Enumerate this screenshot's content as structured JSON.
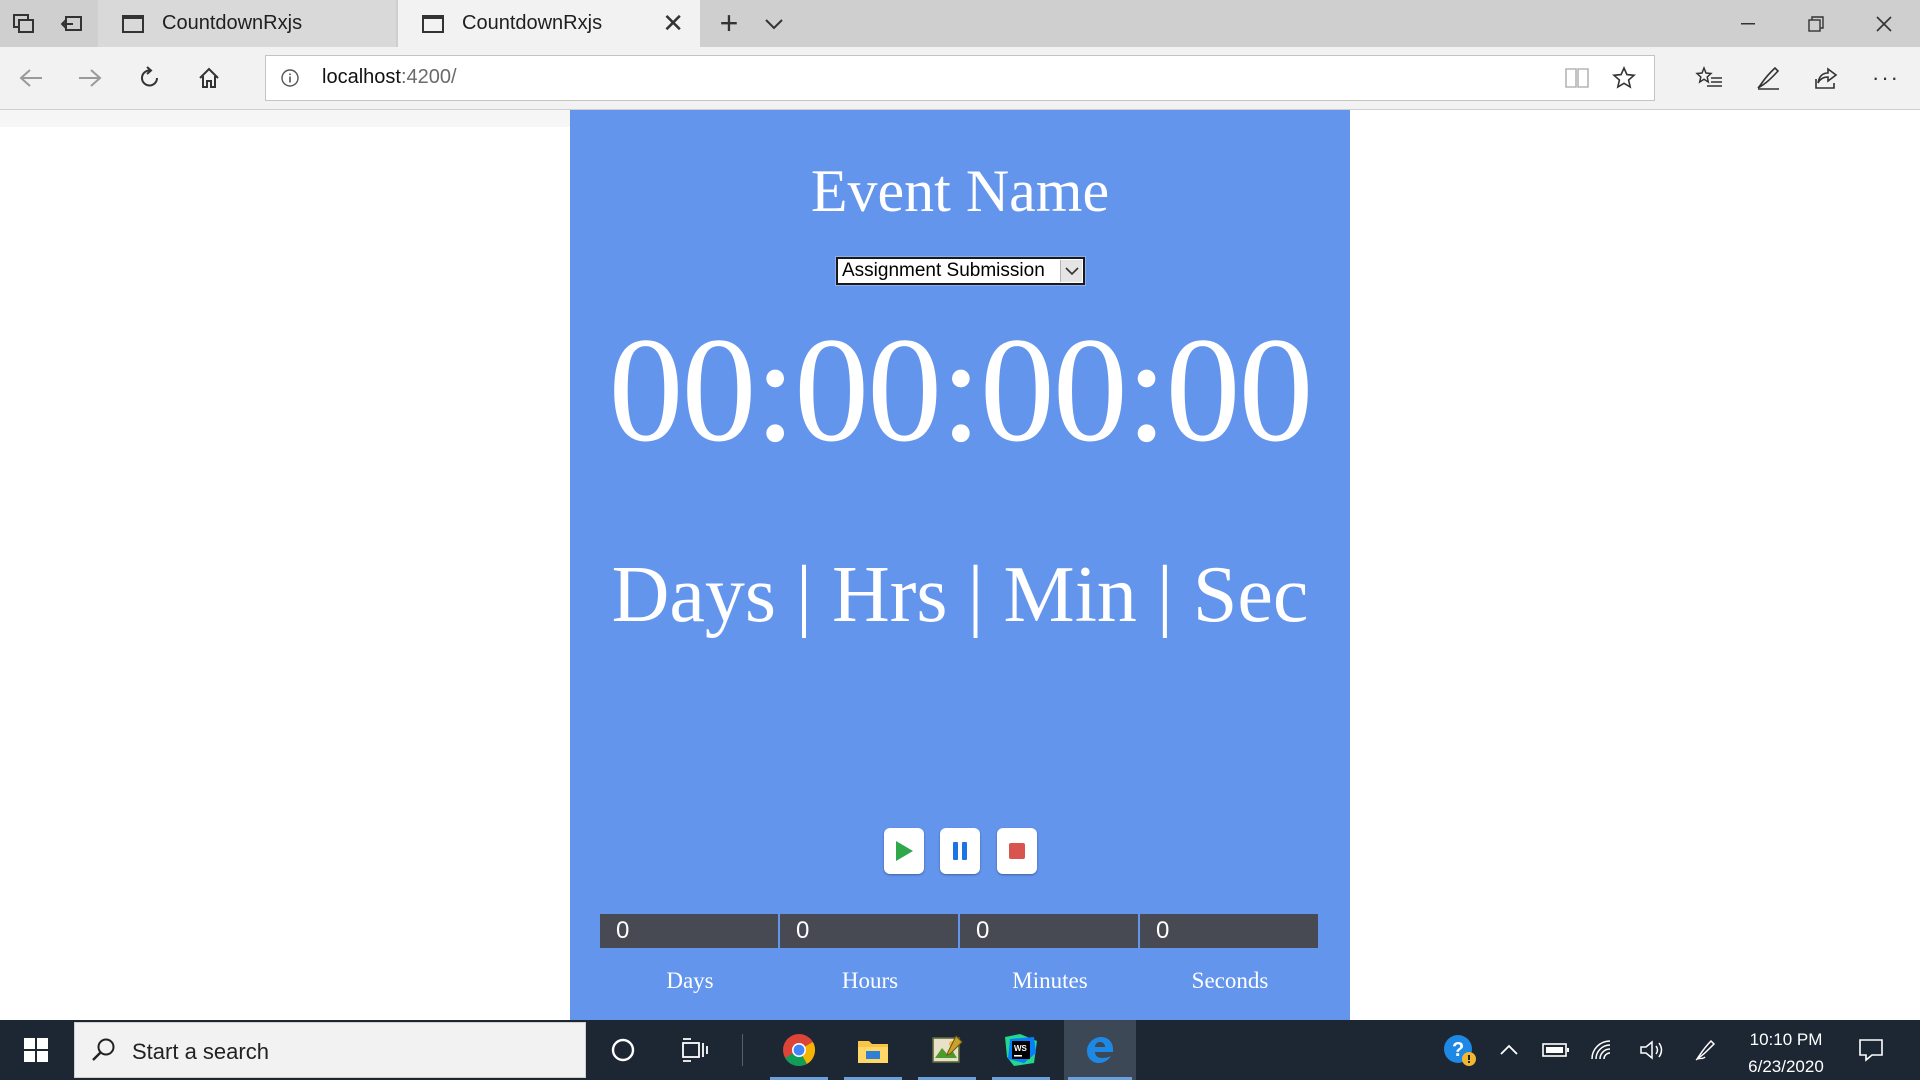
{
  "browser": {
    "tabs": [
      {
        "title": "CountdownRxjs"
      },
      {
        "title": "CountdownRxjs"
      }
    ],
    "new_tab_label": "+",
    "address": {
      "host": "localhost",
      "port_path": ":4200/"
    }
  },
  "app": {
    "title": "Event Name",
    "event_select": {
      "selected": "Assignment Submission"
    },
    "clock": "00:00:00:00",
    "units_label": "Days | Hrs | Min | Sec",
    "counters": [
      {
        "value": "0",
        "label": "Days"
      },
      {
        "value": "0",
        "label": "Hours"
      },
      {
        "value": "0",
        "label": "Minutes"
      },
      {
        "value": "0",
        "label": "Seconds"
      }
    ],
    "colors": {
      "background": "#6495ed",
      "counter_bg": "#474a52",
      "play": "#2ea84a",
      "pause": "#1e73e6",
      "stop": "#d9534f"
    }
  },
  "taskbar": {
    "search_placeholder": "Start a search",
    "time": "10:10 PM",
    "date": "6/23/2020",
    "apps": [
      "cortana-icon",
      "task-view-icon",
      "chrome-icon",
      "file-explorer-icon",
      "image-app-icon",
      "webstorm-icon",
      "edge-icon"
    ]
  }
}
